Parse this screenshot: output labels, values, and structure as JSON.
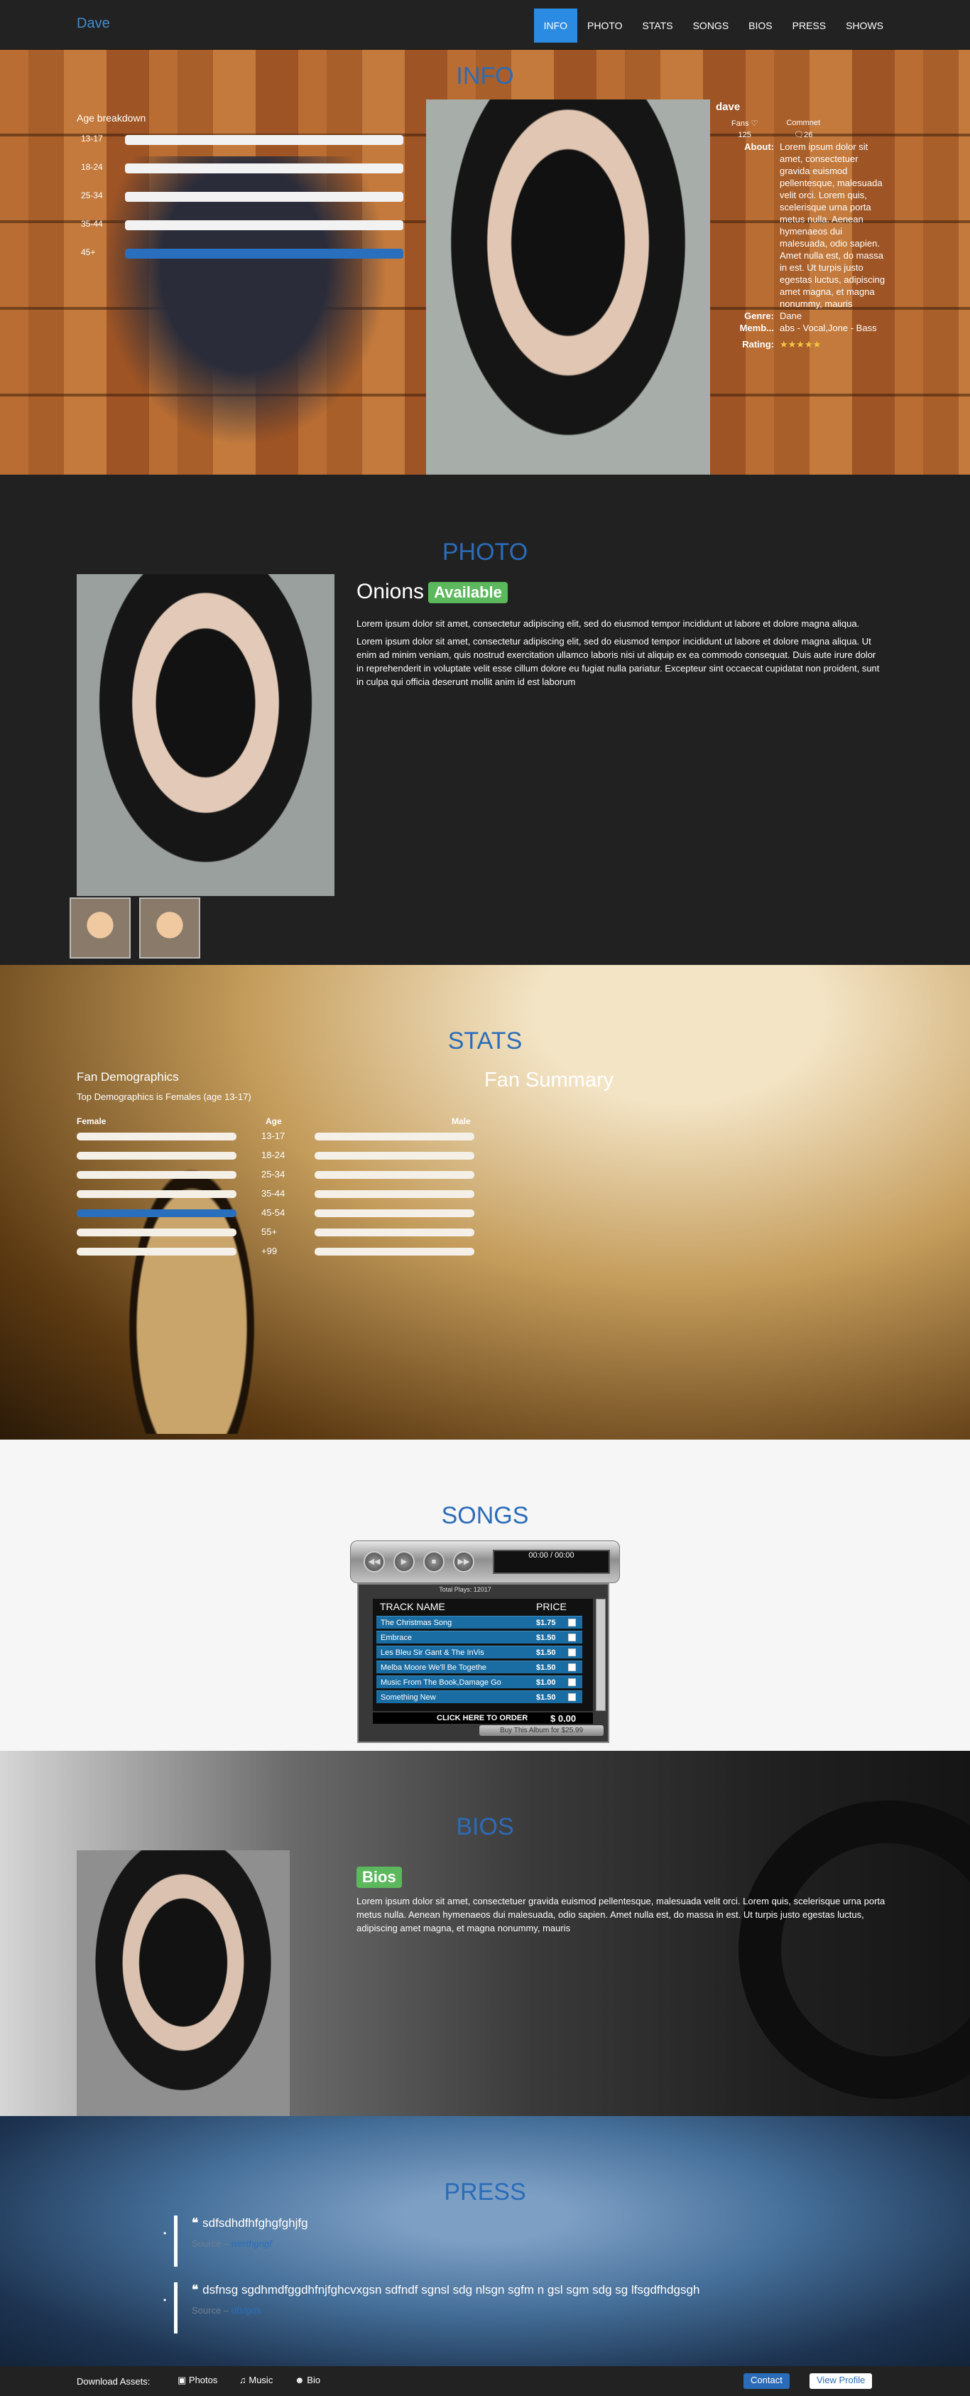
{
  "nav": {
    "brand": "Dave",
    "items": [
      "INFO",
      "PHOTO",
      "STATS",
      "SONGS",
      "BIOS",
      "PRESS",
      "SHOWS"
    ]
  },
  "info": {
    "title": "INFO",
    "age_breakdown": {
      "title": "Age breakdown",
      "rows": [
        {
          "label": "13-17",
          "value": 1.0
        },
        {
          "label": "18-24",
          "value": 1.0
        },
        {
          "label": "25-34",
          "value": 1.0
        },
        {
          "label": "35-44",
          "value": 1.0
        },
        {
          "label": "45+",
          "value": 1.0,
          "highlight": true
        }
      ]
    },
    "profile": {
      "name": "dave",
      "fans_label": "Fans",
      "fans_count": "125",
      "comment_label": "Commnet",
      "comment_count": "26",
      "about_label": "About:",
      "about_text": "Lorem ipsum dolor sit amet, consectetuer gravida euismod pellentesque, malesuada velit orci. Lorem quis, scelerisque urna porta metus nulla. Aenean hymenaeos dui malesuada, odio sapien. Amet nulla est, do massa in est. Ut turpis justo egestas luctus, adipiscing amet magna, et magna nonummy, mauris",
      "genre_label": "Genre:",
      "genre_value": "Dane",
      "members_label": "Memb...",
      "members_value": "abs - Vocal,Jone - Bass",
      "rating_label": "Rating:",
      "rating_stars": "★★★★★"
    }
  },
  "photo": {
    "title": "PHOTO",
    "name": "Onions",
    "badge": "Available",
    "para1": "Lorem ipsum dolor sit amet, consectetur adipiscing elit, sed do eiusmod tempor incididunt ut labore et dolore magna aliqua.",
    "para2": "Lorem ipsum dolor sit amet, consectetur adipiscing elit, sed do eiusmod tempor incididunt ut labore et dolore magna aliqua. Ut enim ad minim veniam, quis nostrud exercitation ullamco laboris nisi ut aliquip ex ea commodo consequat. Duis aute irure dolor in reprehenderit in voluptate velit esse cillum dolore eu fugiat nulla pariatur. Excepteur sint occaecat cupidatat non proident, sunt in culpa qui officia deserunt mollit anim id est laborum"
  },
  "stats": {
    "title": "STATS",
    "demographics_title": "Fan Demographics",
    "demographics_sub": "Top Demographics is Females (age 13-17)",
    "fan_summary": "Fan Summary",
    "col_female": "Female",
    "col_age": "Age",
    "col_male": "Male",
    "rows": [
      {
        "age": "13-17",
        "female": 1.0,
        "male": 1.0
      },
      {
        "age": "18-24",
        "female": 1.0,
        "male": 1.0
      },
      {
        "age": "25-34",
        "female": 1.0,
        "male": 1.0
      },
      {
        "age": "35-44",
        "female": 1.0,
        "male": 1.0
      },
      {
        "age": "45-54",
        "female": 1.0,
        "male": 1.0,
        "highlight": true
      },
      {
        "age": "55+",
        "female": 1.0,
        "male": 1.0
      },
      {
        "age": "+99",
        "female": 1.0,
        "male": 1.0
      }
    ]
  },
  "songs": {
    "title": "SONGS",
    "time_display": "00:00 / 00:00",
    "total_plays": "Total Plays: 12017",
    "col_track": "TRACK NAME",
    "col_price": "PRICE",
    "tracks": [
      {
        "name": "The Christmas Song",
        "price": "$1.75"
      },
      {
        "name": "Embrace",
        "price": "$1.50"
      },
      {
        "name": "Les Bleu Sir Gant & The InVis",
        "price": "$1.50"
      },
      {
        "name": "Melba Moore  We'll Be Togethe",
        "price": "$1.50"
      },
      {
        "name": "Music From The Book,Damage Go",
        "price": "$1.00"
      },
      {
        "name": "Something New",
        "price": "$1.50"
      }
    ],
    "order_label": "CLICK HERE TO ORDER",
    "order_total": "$ 0.00",
    "buy_album": "Buy This Album for $25.99"
  },
  "bios": {
    "title": "BIOS",
    "badge": "Bios",
    "text": "Lorem ipsum dolor sit amet, consectetuer gravida euismod pellentesque, malesuada velit orci. Lorem quis, scelerisque urna porta metus nulla. Aenean hymenaeos dui malesuada, odio sapien. Amet nulla est, do massa in est. Ut turpis justo egestas luctus, adipiscing amet magna, et magna nonummy, mauris"
  },
  "press": {
    "title": "PRESS",
    "quotes": [
      {
        "text": "sdfsdhdfhfghgfghjfg",
        "source_prefix": "Source –",
        "source_link": "werthgngf"
      },
      {
        "text": "dsfnsg sgdhmdfggdhfnjfghcvxgsn sdfndf sgnsl sdg nlsgn sgfm n gsl sgm sdg sg lfsgdfhdgsgh",
        "source_prefix": "Source –",
        "source_link": "dfsfgds"
      }
    ]
  },
  "footer": {
    "label": "Download Assets:",
    "links": [
      "Photos",
      "Music",
      "Bio"
    ],
    "contact": "Contact",
    "view_profile": "View Profile"
  },
  "colors": {
    "accent": "#2b8ae2",
    "title_blue": "#2b6cb8",
    "badge_green": "#5cb85c"
  }
}
